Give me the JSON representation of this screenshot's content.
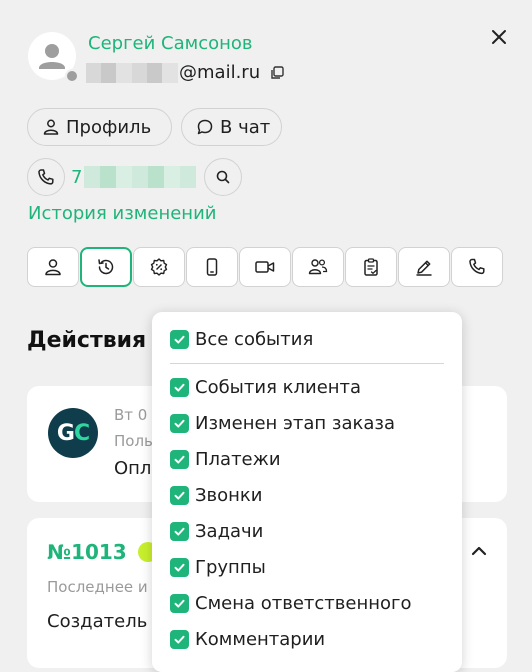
{
  "header": {
    "client_name": "Сергей Самсонов",
    "email_suffix": "@mail.ru",
    "profile_label": "Профиль",
    "chat_label": "В чат",
    "phone_prefix": "7",
    "history_link": "История изменений"
  },
  "tabs": [
    {
      "icon": "user-icon",
      "active": false
    },
    {
      "icon": "history-icon",
      "active": true
    },
    {
      "icon": "discount-icon",
      "active": false
    },
    {
      "icon": "mobile-icon",
      "active": false
    },
    {
      "icon": "video-icon",
      "active": false
    },
    {
      "icon": "users-icon",
      "active": false
    },
    {
      "icon": "clipboard-icon",
      "active": false
    },
    {
      "icon": "pen-icon",
      "active": false
    },
    {
      "icon": "phone-icon",
      "active": false
    }
  ],
  "actions": {
    "title": "Действия",
    "event": {
      "avatar_text_g": "G",
      "avatar_text_c": "C",
      "date": "Вт 0",
      "user": "Поль",
      "text": "Опл"
    },
    "order": {
      "number": "№1013",
      "last_label": "Последнее и",
      "creator_label": "Создатель"
    }
  },
  "filter_dropdown": {
    "all_label": "Все события",
    "items": [
      "События клиента",
      "Изменен этап заказа",
      "Платежи",
      "Звонки",
      "Задачи",
      "Группы",
      "Смена ответственного",
      "Комментарии"
    ]
  },
  "colors": {
    "accent": "#1fb47a",
    "badge": "#c8ef2d",
    "avatar_bg": "#0f3d4c"
  }
}
